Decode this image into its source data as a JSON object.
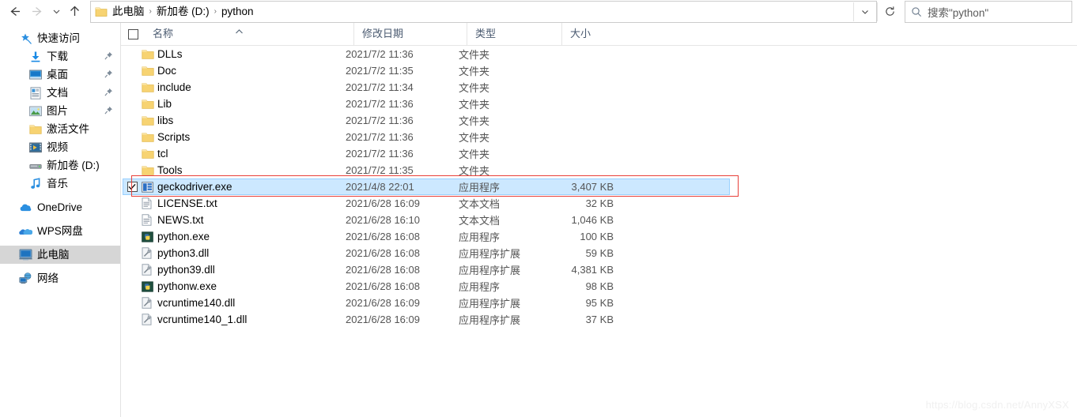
{
  "window": {
    "title": "python"
  },
  "toolbar": {
    "back_label": "back-arrow",
    "forward_label": "forward-arrow",
    "recent_label": "recent-locations-chevron",
    "up_label": "up-one-level",
    "refresh_label": "refresh"
  },
  "breadcrumb": {
    "separator": "›",
    "items": [
      "此电脑",
      "新加卷 (D:)",
      "python"
    ]
  },
  "search": {
    "value": "搜索\"python\"",
    "placeholder": "搜索\"python\""
  },
  "sidebar": {
    "items": [
      {
        "label": "快速访问",
        "icon": "star-pin-icon",
        "indent": false,
        "pinned": false,
        "selected": false
      },
      {
        "label": "下载",
        "icon": "downloads-icon",
        "indent": true,
        "pinned": true,
        "selected": false
      },
      {
        "label": "桌面",
        "icon": "desktop-icon",
        "indent": true,
        "pinned": true,
        "selected": false
      },
      {
        "label": "文档",
        "icon": "documents-icon",
        "indent": true,
        "pinned": true,
        "selected": false
      },
      {
        "label": "图片",
        "icon": "pictures-icon",
        "indent": true,
        "pinned": true,
        "selected": false
      },
      {
        "label": "激活文件",
        "icon": "folder-icon",
        "indent": true,
        "pinned": false,
        "selected": false
      },
      {
        "label": "视频",
        "icon": "videos-icon",
        "indent": true,
        "pinned": false,
        "selected": false
      },
      {
        "label": "新加卷 (D:)",
        "icon": "drive-icon",
        "indent": true,
        "pinned": false,
        "selected": false
      },
      {
        "label": "音乐",
        "icon": "music-icon",
        "indent": true,
        "pinned": false,
        "selected": false
      },
      {
        "label": "OneDrive",
        "icon": "onedrive-cloud-icon",
        "indent": false,
        "pinned": false,
        "selected": false
      },
      {
        "label": "WPS网盘",
        "icon": "wps-cloud-icon",
        "indent": false,
        "pinned": false,
        "selected": false
      },
      {
        "label": "此电脑",
        "icon": "this-pc-icon",
        "indent": false,
        "pinned": false,
        "selected": true
      },
      {
        "label": "网络",
        "icon": "network-icon",
        "indent": false,
        "pinned": false,
        "selected": false
      }
    ]
  },
  "filelist": {
    "columns": [
      {
        "key": "name",
        "label": "名称",
        "sort": "asc"
      },
      {
        "key": "date",
        "label": "修改日期",
        "sort": "none"
      },
      {
        "key": "type",
        "label": "类型",
        "sort": "none"
      },
      {
        "key": "size",
        "label": "大小",
        "sort": "none"
      }
    ],
    "rows": [
      {
        "name": "DLLs",
        "date": "2021/7/2 11:36",
        "type": "文件夹",
        "size": "",
        "icon": "folder-icon",
        "selected": false,
        "checked": false
      },
      {
        "name": "Doc",
        "date": "2021/7/2 11:35",
        "type": "文件夹",
        "size": "",
        "icon": "folder-icon",
        "selected": false,
        "checked": false
      },
      {
        "name": "include",
        "date": "2021/7/2 11:34",
        "type": "文件夹",
        "size": "",
        "icon": "folder-icon",
        "selected": false,
        "checked": false
      },
      {
        "name": "Lib",
        "date": "2021/7/2 11:36",
        "type": "文件夹",
        "size": "",
        "icon": "folder-icon",
        "selected": false,
        "checked": false
      },
      {
        "name": "libs",
        "date": "2021/7/2 11:36",
        "type": "文件夹",
        "size": "",
        "icon": "folder-icon",
        "selected": false,
        "checked": false
      },
      {
        "name": "Scripts",
        "date": "2021/7/2 11:36",
        "type": "文件夹",
        "size": "",
        "icon": "folder-icon",
        "selected": false,
        "checked": false
      },
      {
        "name": "tcl",
        "date": "2021/7/2 11:36",
        "type": "文件夹",
        "size": "",
        "icon": "folder-icon",
        "selected": false,
        "checked": false
      },
      {
        "name": "Tools",
        "date": "2021/7/2 11:35",
        "type": "文件夹",
        "size": "",
        "icon": "folder-icon",
        "selected": false,
        "checked": false
      },
      {
        "name": "geckodriver.exe",
        "date": "2021/4/8 22:01",
        "type": "应用程序",
        "size": "3,407 KB",
        "icon": "exe-generic-icon",
        "selected": true,
        "checked": true
      },
      {
        "name": "LICENSE.txt",
        "date": "2021/6/28 16:09",
        "type": "文本文档",
        "size": "32 KB",
        "icon": "text-file-icon",
        "selected": false,
        "checked": false
      },
      {
        "name": "NEWS.txt",
        "date": "2021/6/28 16:10",
        "type": "文本文档",
        "size": "1,046 KB",
        "icon": "text-file-icon",
        "selected": false,
        "checked": false
      },
      {
        "name": "python.exe",
        "date": "2021/6/28 16:08",
        "type": "应用程序",
        "size": "100 KB",
        "icon": "python-exe-icon",
        "selected": false,
        "checked": false
      },
      {
        "name": "python3.dll",
        "date": "2021/6/28 16:08",
        "type": "应用程序扩展",
        "size": "59 KB",
        "icon": "dll-file-icon",
        "selected": false,
        "checked": false
      },
      {
        "name": "python39.dll",
        "date": "2021/6/28 16:08",
        "type": "应用程序扩展",
        "size": "4,381 KB",
        "icon": "dll-file-icon",
        "selected": false,
        "checked": false
      },
      {
        "name": "pythonw.exe",
        "date": "2021/6/28 16:08",
        "type": "应用程序",
        "size": "98 KB",
        "icon": "python-exe-icon",
        "selected": false,
        "checked": false
      },
      {
        "name": "vcruntime140.dll",
        "date": "2021/6/28 16:09",
        "type": "应用程序扩展",
        "size": "95 KB",
        "icon": "dll-file-icon",
        "selected": false,
        "checked": false
      },
      {
        "name": "vcruntime140_1.dll",
        "date": "2021/6/28 16:09",
        "type": "应用程序扩展",
        "size": "37 KB",
        "icon": "dll-file-icon",
        "selected": false,
        "checked": false
      }
    ]
  },
  "annotation": {
    "highlight_color": "#e8403a",
    "highlight_row": "geckodriver.exe"
  },
  "watermark": {
    "text": "https://blog.csdn.net/AnnyXSX"
  },
  "colors": {
    "selection_fill": "#cce8ff",
    "selection_border": "#99d1ff",
    "sidebar_selected": "#d6d6d6",
    "folder_yellow": "#f7d372",
    "header_text": "#4a5a70"
  }
}
